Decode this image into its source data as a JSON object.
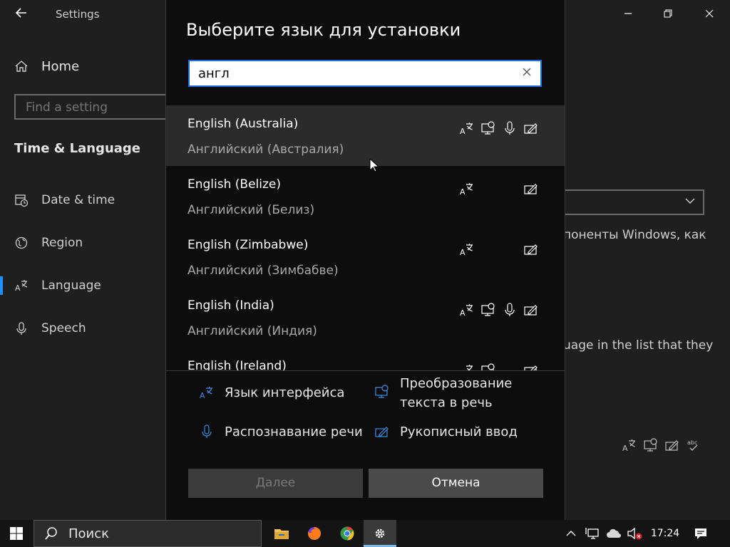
{
  "settings": {
    "app_title": "Settings",
    "home_label": "Home",
    "find_placeholder": "Find a setting",
    "section_title": "Time & Language",
    "nav": [
      {
        "label": "Date & time",
        "icon": "calendar-clock-icon"
      },
      {
        "label": "Region",
        "icon": "globe-icon"
      },
      {
        "label": "Language",
        "icon": "language-icon"
      },
      {
        "label": "Speech",
        "icon": "microphone-icon"
      }
    ],
    "selected_nav": "Language",
    "bg_text_1": "понeнты Windows, как",
    "bg_text_2": "uage in the list that they"
  },
  "dialog": {
    "title": "Выберите язык для установки",
    "search_value": "англ",
    "languages": [
      {
        "name": "English (Australia)",
        "native": "Английский (Австралия)",
        "features": {
          "interface": true,
          "tts": true,
          "speech": true,
          "handwriting": true
        }
      },
      {
        "name": "English (Belize)",
        "native": "Английский (Белиз)",
        "features": {
          "interface": true,
          "tts": false,
          "speech": false,
          "handwriting": true
        }
      },
      {
        "name": "English (Zimbabwe)",
        "native": "Английский (Зимбабве)",
        "features": {
          "interface": true,
          "tts": false,
          "speech": false,
          "handwriting": true
        }
      },
      {
        "name": "English (India)",
        "native": "Английский (Индия)",
        "features": {
          "interface": true,
          "tts": true,
          "speech": true,
          "handwriting": true
        }
      },
      {
        "name": "English (Ireland)",
        "native": "",
        "features": {
          "interface": true,
          "tts": true,
          "speech": false,
          "handwriting": true
        }
      }
    ],
    "legend": {
      "interface": "Язык интерфейса",
      "tts_line1": "Преобразование",
      "tts_line2": "текста в речь",
      "speech": "Распознавание речи",
      "handwriting": "Рукописный ввод"
    },
    "next_label": "Далее",
    "cancel_label": "Отмена"
  },
  "taskbar": {
    "search_label": "Поиск",
    "time": "17:24"
  },
  "colors": {
    "accent": "#1e6fd8",
    "legend_icon": "#3a8ee6"
  }
}
